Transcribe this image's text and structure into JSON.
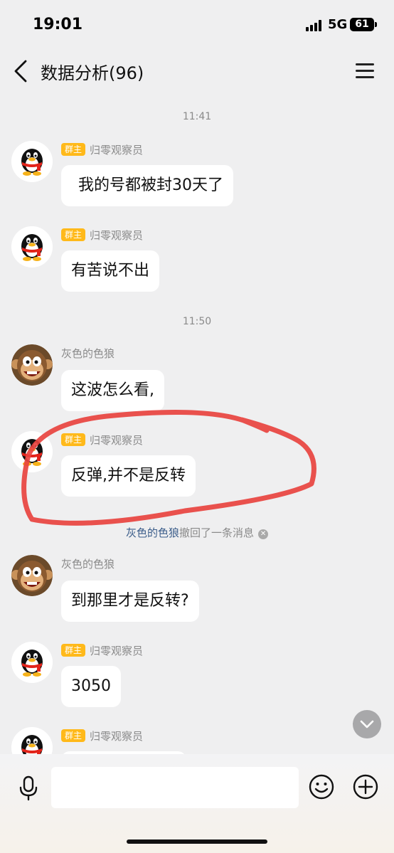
{
  "status": {
    "time": "19:01",
    "network": "5G",
    "battery": "61"
  },
  "header": {
    "title": "数据分析(96)"
  },
  "timestamps": [
    "11:41",
    "11:50"
  ],
  "messages": [
    {
      "badge": "群主",
      "sender": "归零观察员",
      "text": "我的号都被封30天了",
      "avatar": "penguin-icon"
    },
    {
      "badge": "群主",
      "sender": "归零观察员",
      "text": "有苦说不出",
      "avatar": "penguin-icon"
    },
    {
      "badge": "",
      "sender": "灰色的色狼",
      "text": "这波怎么看,",
      "avatar": "monkey-icon"
    },
    {
      "badge": "群主",
      "sender": "归零观察员",
      "text": "反弹,并不是反转",
      "avatar": "penguin-icon"
    },
    {
      "badge": "",
      "sender": "灰色的色狼",
      "text": "到那里才是反转?",
      "avatar": "monkey-icon"
    },
    {
      "badge": "群主",
      "sender": "归零观察员",
      "text": "3050",
      "avatar": "penguin-icon"
    },
    {
      "badge": "群主",
      "sender": "归零观察员",
      "text": "",
      "avatar": "penguin-icon"
    }
  ],
  "recall_notice": {
    "who": "灰色的色狼",
    "text": "撤回了一条消息"
  },
  "input": {
    "placeholder": ""
  },
  "colors": {
    "badge": "#ffb91a",
    "background": "#efeff0",
    "annotation": "#e8433f",
    "link": "#3b5d8a"
  }
}
